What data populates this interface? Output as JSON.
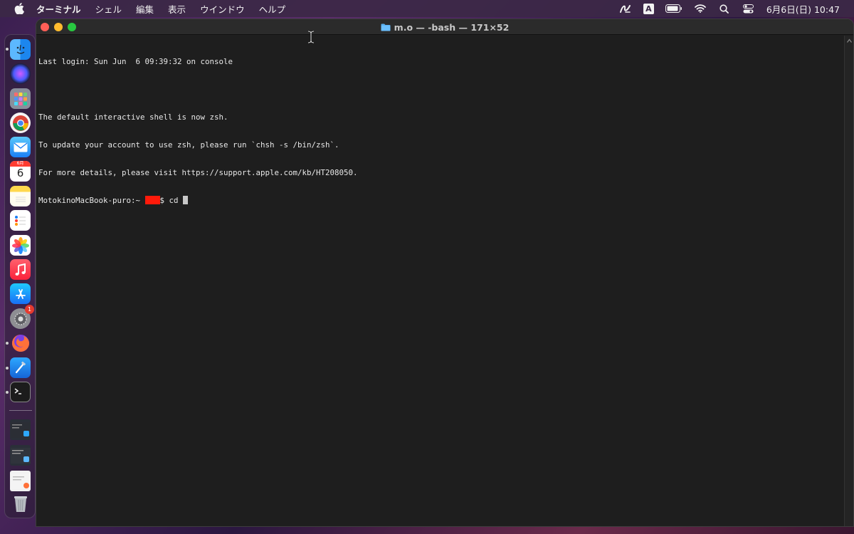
{
  "menubar": {
    "apple_icon": "apple-icon",
    "app_name": "ターミナル",
    "items": [
      "シェル",
      "編集",
      "表示",
      "ウインドウ",
      "ヘルプ"
    ],
    "status_icons": [
      "script-icon",
      "input-source-icon",
      "battery-icon",
      "wifi-icon",
      "spotlight-icon",
      "control-center-icon"
    ],
    "input_source_label": "A",
    "clock": "6月6日(日)  10:47"
  },
  "dock": {
    "apps": [
      {
        "name": "finder",
        "icon": "finder-icon"
      },
      {
        "name": "siri",
        "icon": "siri-icon"
      },
      {
        "name": "launchpad",
        "icon": "launchpad-icon"
      },
      {
        "name": "chrome",
        "icon": "chrome-icon"
      },
      {
        "name": "mail",
        "icon": "mail-icon"
      },
      {
        "name": "calendar",
        "icon": "calendar-icon",
        "month": "6月",
        "day": "6"
      },
      {
        "name": "notes",
        "icon": "notes-icon"
      },
      {
        "name": "reminders",
        "icon": "reminders-icon"
      },
      {
        "name": "photos",
        "icon": "photos-icon"
      },
      {
        "name": "music",
        "icon": "music-icon"
      },
      {
        "name": "app-store",
        "icon": "app-store-icon"
      },
      {
        "name": "system-preferences",
        "icon": "system-preferences-icon",
        "badge": "1"
      },
      {
        "name": "firefox",
        "icon": "firefox-icon"
      },
      {
        "name": "xcode",
        "icon": "xcode-icon"
      },
      {
        "name": "terminal",
        "icon": "terminal-icon"
      }
    ],
    "trash_icon": "trash-icon"
  },
  "window": {
    "title": "m.o — -bash — 171×52",
    "folder_icon": "folder-icon",
    "lines": [
      "Last login: Sun Jun  6 09:39:32 on console",
      "",
      "The default interactive shell is now zsh.",
      "To update your account to use zsh, please run `chsh -s /bin/zsh`.",
      "For more details, please visit https://support.apple.com/kb/HT208050."
    ],
    "prompt_prefix": "MotokinoMacBook-puro:~ ",
    "prompt_suffix": "$ ",
    "command": "cd "
  },
  "colors": {
    "terminal_bg": "#1e1e1e",
    "terminal_fg": "#e8e8e8",
    "redaction": "#ff1a0a"
  }
}
